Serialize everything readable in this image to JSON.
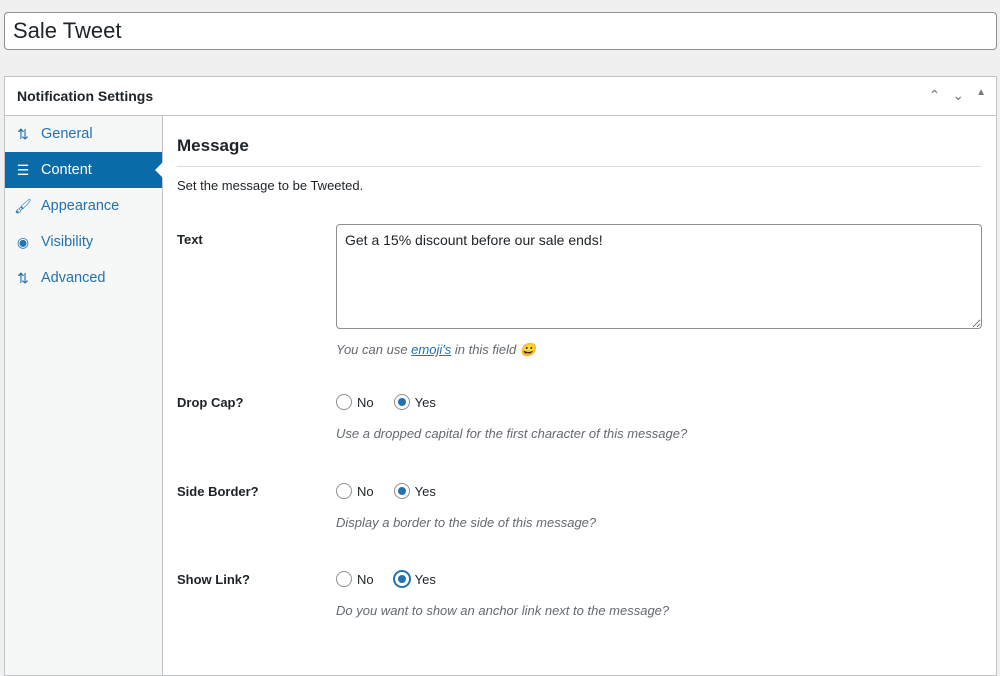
{
  "title": "Sale Tweet",
  "box": {
    "heading": "Notification Settings",
    "controls": [
      "chevron-up-icon",
      "chevron-down-icon",
      "triangle-up-icon"
    ]
  },
  "sidebar": {
    "items": [
      {
        "label": "General",
        "icon": "sliders-icon"
      },
      {
        "label": "Content",
        "icon": "text-icon",
        "active": true
      },
      {
        "label": "Appearance",
        "icon": "brush-icon"
      },
      {
        "label": "Visibility",
        "icon": "eye-icon"
      },
      {
        "label": "Advanced",
        "icon": "sliders-icon"
      }
    ]
  },
  "main": {
    "section_title": "Message",
    "section_desc": "Set the message to be Tweeted.",
    "text": {
      "label": "Text",
      "value": "Get a 15% discount before our sale ends!",
      "hint_pre": "You can use ",
      "hint_link": "emoji's",
      "hint_post": " in this field 😀"
    },
    "fields": [
      {
        "label": "Drop Cap?",
        "no": "No",
        "yes": "Yes",
        "selected": "Yes",
        "hint": "Use a dropped capital for the first character of this message?"
      },
      {
        "label": "Side Border?",
        "no": "No",
        "yes": "Yes",
        "selected": "Yes",
        "hint": "Display a border to the side of this message?"
      },
      {
        "label": "Show Link?",
        "no": "No",
        "yes": "Yes",
        "selected": "Yes",
        "hint": "Do you want to show an anchor link next to the message?"
      }
    ]
  },
  "colors": {
    "accent": "#2271b1",
    "active_bg": "#0a6ba8"
  }
}
